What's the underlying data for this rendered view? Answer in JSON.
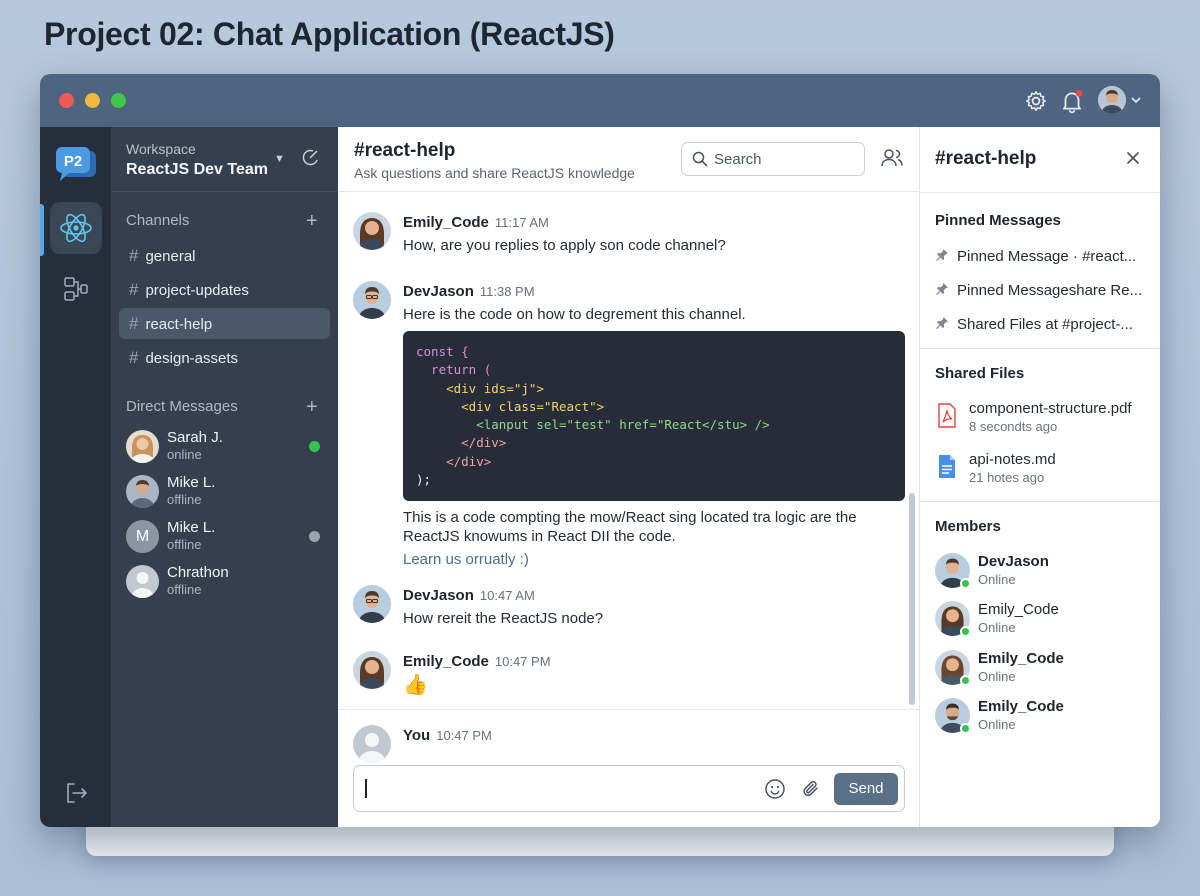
{
  "page": {
    "heading": "Project 02: Chat Application (ReactJS)"
  },
  "colors": {
    "titlebar": "#4e6481",
    "rail": "#252f3c",
    "sidebar": "#35404f",
    "accent": "#5aa6e6",
    "send": "#5a7088",
    "online": "#36c04f"
  },
  "titlebar": {
    "icons": [
      "gear-icon",
      "bell-icon",
      "avatar",
      "chevron-down-icon"
    ]
  },
  "rail": {
    "logo": "P2",
    "items": [
      "react-icon",
      "file-tree-icon",
      "logout-icon"
    ]
  },
  "sidebar": {
    "workspace_label": "Workspace",
    "workspace_name": "ReactJS Dev Team",
    "channels_title": "Channels",
    "channels": [
      "general",
      "project-updates",
      "react-help",
      "design-assets"
    ],
    "active_channel": "react-help",
    "dm_title": "Direct Messages",
    "dms": [
      {
        "name": "Sarah J.",
        "status": "online",
        "dot": "#36c04f"
      },
      {
        "name": "Mike L.",
        "status": "offline",
        "dot": ""
      },
      {
        "name": "Mike L.",
        "status": "offline",
        "initial": "M",
        "dot": "#9aa4b0"
      },
      {
        "name": "Chrathon",
        "status": "offline",
        "dot": ""
      }
    ]
  },
  "chat": {
    "title": "#react-help",
    "subtitle": "Ask questions and share ReactJS knowledge",
    "search_placeholder": "Search",
    "messages": [
      {
        "author": "Emily_Code",
        "time": "11:17 AM",
        "text": "How, are you replies to apply son code channel?"
      },
      {
        "author": "DevJason",
        "time": "11:38 PM",
        "text": "Here is the code on how to degrement this channel."
      },
      {
        "author": "DevJason",
        "time": "10:47 AM",
        "text": "How rereit the ReactJS node?"
      },
      {
        "author": "Emily_Code",
        "time": "10:47 PM",
        "text": "👍"
      },
      {
        "author": "You",
        "time": "10:47 PM",
        "text": ""
      }
    ],
    "code_lines": [
      "const {",
      "  return (",
      "    <div ids=\"j\">",
      "      <div class=\"React\">",
      "        <lanput sel=\"test\" href=\"React</stu> />",
      "      </div>",
      "    </div>",
      ");"
    ],
    "after_code_1": "This is a code compting the mow/React sing located tra logic are the",
    "after_code_2": "ReactJS knowums in React DII the code.",
    "after_code_link": "Learn us orruatly :)",
    "composer_value": "",
    "send_label": "Send"
  },
  "panel": {
    "title": "#react-help",
    "pinned_title": "Pinned Messages",
    "pinned": [
      "Pinned Message · #react...",
      "Pinned Messageshare Re...",
      "Shared Files at #project-..."
    ],
    "files_title": "Shared Files",
    "files": [
      {
        "name": "component-structure.pdf",
        "meta": "8 secondts ago",
        "icon": "pdf-file-icon"
      },
      {
        "name": "api-notes.md",
        "meta": "21 hotes ago",
        "icon": "doc-file-icon"
      }
    ],
    "members_title": "Members",
    "members": [
      {
        "name": "DevJason",
        "status": "Online",
        "bold": true
      },
      {
        "name": "Emily_Code",
        "status": "Online",
        "bold": false
      },
      {
        "name": "Emily_Code",
        "status": "Online",
        "bold": true
      },
      {
        "name": "Emily_Code",
        "status": "Online",
        "bold": true
      }
    ]
  }
}
